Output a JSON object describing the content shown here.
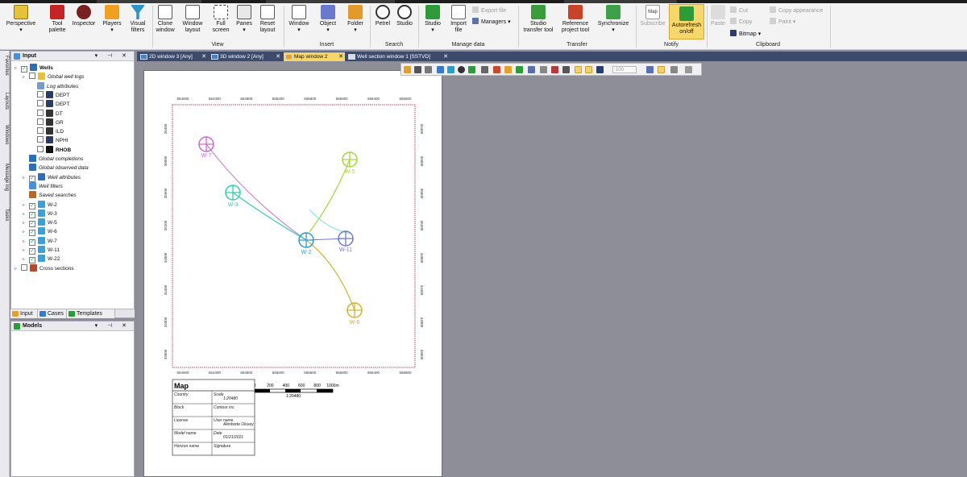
{
  "ribbon": {
    "buttons": [
      {
        "label": "Perspective",
        "icon": "perspective-icon"
      },
      {
        "label": "Tool palette",
        "icon": "tool-palette-icon"
      },
      {
        "label": "Inspector",
        "icon": "inspector-icon"
      },
      {
        "label": "Players",
        "icon": "players-icon"
      },
      {
        "label": "Visual filters",
        "icon": "filter-icon"
      },
      {
        "label": "Clone window",
        "icon": "clone-window-icon"
      },
      {
        "label": "Window layout",
        "icon": "window-layout-icon"
      },
      {
        "label": "Full screen",
        "icon": "full-screen-icon"
      },
      {
        "label": "Panes",
        "icon": "panes-icon"
      },
      {
        "label": "Reset layout",
        "icon": "reset-layout-icon"
      },
      {
        "label": "Window",
        "icon": "window-icon"
      },
      {
        "label": "Object",
        "icon": "object-icon"
      },
      {
        "label": "Folder",
        "icon": "folder-icon"
      },
      {
        "label": "Petrel",
        "icon": "petrel-search-icon"
      },
      {
        "label": "Studio",
        "icon": "studio-search-icon"
      },
      {
        "label": "Studio",
        "icon": "studio-icon"
      },
      {
        "label": "Import file",
        "icon": "import-file-icon"
      },
      {
        "label": "Studio transfer tool",
        "icon": "studio-transfer-icon"
      },
      {
        "label": "Reference project tool",
        "icon": "reference-project-icon"
      },
      {
        "label": "Synchronize",
        "icon": "synchronize-icon"
      },
      {
        "label": "Subscribe",
        "icon": "subscribe-icon"
      },
      {
        "label": "Autorefresh on/off",
        "icon": "autorefresh-icon"
      },
      {
        "label": "Paste",
        "icon": "paste-icon"
      }
    ],
    "small": {
      "export_file": "Export file",
      "managers": "Managers",
      "cut": "Cut",
      "copy": "Copy",
      "bitmap": "Bitmap",
      "copy_appearance": "Copy appearance",
      "paint": "Paint",
      "map": "Map"
    },
    "groups": [
      "View",
      "Insert",
      "Search",
      "Manage data",
      "Transfer",
      "Notify",
      "Clipboard"
    ]
  },
  "side_tabs": [
    "Favorites",
    "Layouts",
    "Windows",
    "Message log",
    "Tasks"
  ],
  "input_panel": {
    "title": "Input",
    "items": [
      {
        "label": "Wells",
        "level": 0,
        "style": "bold",
        "checked": true
      },
      {
        "label": "Global well logs",
        "level": 1,
        "style": "italic",
        "checked": false
      },
      {
        "label": "Log attributes",
        "level": 2,
        "style": "italic",
        "checked": null
      },
      {
        "label": "DEPT",
        "level": 2,
        "style": "",
        "checked": false
      },
      {
        "label": "DEPT",
        "level": 2,
        "style": "",
        "checked": false
      },
      {
        "label": "DT",
        "level": 2,
        "style": "",
        "checked": false
      },
      {
        "label": "GR",
        "level": 2,
        "style": "",
        "checked": false
      },
      {
        "label": "ILD",
        "level": 2,
        "style": "",
        "checked": false
      },
      {
        "label": "NPHI",
        "level": 2,
        "style": "",
        "checked": false
      },
      {
        "label": "RHOB",
        "level": 2,
        "style": "bold",
        "checked": false
      },
      {
        "label": "Global completions",
        "level": 1,
        "style": "italic",
        "checked": null
      },
      {
        "label": "Global observed data",
        "level": 1,
        "style": "italic",
        "checked": null
      },
      {
        "label": "Well attributes",
        "level": 1,
        "style": "italic",
        "checked": true
      },
      {
        "label": "Well filters",
        "level": 1,
        "style": "italic",
        "checked": null
      },
      {
        "label": "Saved searches",
        "level": 1,
        "style": "italic",
        "checked": null
      },
      {
        "label": "W-2",
        "level": 1,
        "style": "",
        "checked": true
      },
      {
        "label": "W-3",
        "level": 1,
        "style": "",
        "checked": true
      },
      {
        "label": "W-5",
        "level": 1,
        "style": "",
        "checked": true
      },
      {
        "label": "W-6",
        "level": 1,
        "style": "",
        "checked": true
      },
      {
        "label": "W-7",
        "level": 1,
        "style": "",
        "checked": true
      },
      {
        "label": "W-11",
        "level": 1,
        "style": "",
        "checked": true
      },
      {
        "label": "W-22",
        "level": 1,
        "style": "",
        "checked": true
      },
      {
        "label": "Cross sections",
        "level": 0,
        "style": "",
        "checked": false
      }
    ],
    "bottom_tabs": [
      "Input",
      "Cases",
      "Templates"
    ]
  },
  "models_panel": {
    "title": "Models"
  },
  "doc_tabs": [
    {
      "label": "2D window 3 [Any]",
      "active": false
    },
    {
      "label": "3D window 2 [Any]",
      "active": false
    },
    {
      "label": "Map window 2",
      "active": true
    },
    {
      "label": "Well section window 1 [SSTVD]",
      "active": false
    }
  ],
  "plot_toolbar": {
    "zoom_value": "100"
  },
  "map": {
    "x_ticks": [
      "654000",
      "654400",
      "654800",
      "655200",
      "655600",
      "656000",
      "656400",
      "656800"
    ],
    "y_ticks": [
      "36400",
      "36000",
      "35600",
      "35200",
      "34800",
      "34400",
      "34000",
      "33600"
    ],
    "wells": [
      {
        "name": "W-7",
        "color": "#c86ad0"
      },
      {
        "name": "W-3",
        "color": "#2fcfb2"
      },
      {
        "name": "W-2",
        "color": "#2c9bd0"
      },
      {
        "name": "W-11",
        "color": "#6e7ac8"
      },
      {
        "name": "W-5",
        "color": "#a6d63a"
      },
      {
        "name": "W-6",
        "color": "#d3b22a"
      }
    ],
    "scale_bar": {
      "labels": [
        "0",
        "200",
        "400",
        "600",
        "800",
        "1000m"
      ],
      "ratio": "1:20480"
    },
    "info_box": {
      "title": "Map",
      "cells": [
        [
          "Country",
          "Scale",
          "1:20480"
        ],
        [
          "Block",
          "Contour inc",
          ""
        ],
        [
          "License",
          "User name",
          "Akinbode Olusey"
        ],
        [
          "Model name",
          "Date",
          "01/21/2021"
        ],
        [
          "Horizon name",
          "Signature",
          ""
        ]
      ]
    }
  }
}
